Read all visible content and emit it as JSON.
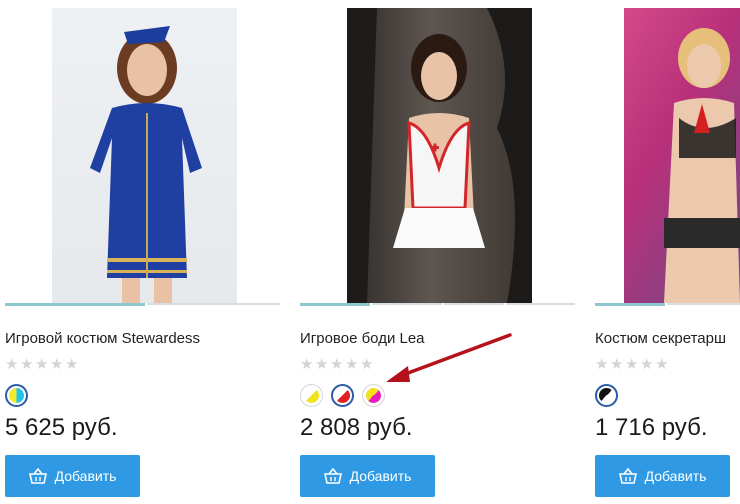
{
  "products": [
    {
      "title": "Игровой костюм Stewardess",
      "rating_max": 5,
      "rating": 0,
      "price": "5 625 руб.",
      "add_label": "Добавить",
      "colors": [
        {
          "fill": "conic-gradient(#1fc4ef 0 50%, #f2ec2c 50% 100%)",
          "selected": true
        }
      ]
    },
    {
      "title": "Игровое боди Lea",
      "rating_max": 5,
      "rating": 0,
      "price": "2 808 руб.",
      "add_label": "Добавить",
      "colors": [
        {
          "fill": "linear-gradient(135deg, #ffffff 50%, #f2e21a 50%)",
          "selected": false
        },
        {
          "fill": "linear-gradient(135deg, #ffffff 50%, #e02020 50%)",
          "selected": true
        },
        {
          "fill": "linear-gradient(135deg, #f2e21a 50%, #e61ec0 50%)",
          "selected": false
        }
      ]
    },
    {
      "title": "Костюм секретарш",
      "rating_max": 5,
      "rating": 0,
      "price": "1 716 руб.",
      "add_label": "Добавить",
      "colors": [
        {
          "fill": "linear-gradient(135deg, #111111 50%, #ffffff 50%)",
          "selected": true
        }
      ]
    }
  ],
  "accent_color": "#2f9ae3",
  "annotation_arrow_color": "#b5121b"
}
